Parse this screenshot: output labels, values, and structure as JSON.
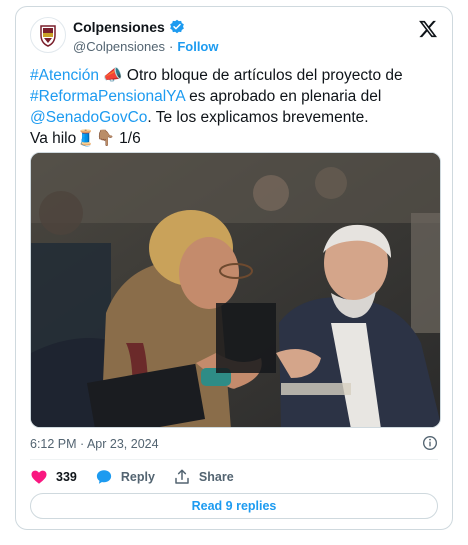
{
  "account": {
    "name": "Colpensiones",
    "handle": "@Colpensiones",
    "separator": "·",
    "follow_label": "Follow"
  },
  "tweet": {
    "line1_tag": "#Atención",
    "line1_emoji": "📣",
    "line1_rest": " Otro bloque de artículos del proyecto de",
    "line2_tag": "#ReformaPensionalYA",
    "line2_rest": " es aprobado en plenaria del",
    "line3_mention": "@SenadoGovCo",
    "line3_rest": ". Te los explicamos brevemente.",
    "line4_text": "Va hilo",
    "line4_emojis": "🧵👇🏽",
    "line4_count": " 1/6"
  },
  "meta": {
    "timestamp": "6:12 PM · Apr 23, 2024"
  },
  "actions": {
    "like_count": "339",
    "reply_label": "Reply",
    "share_label": "Share"
  },
  "read_replies_label": "Read 9 replies",
  "colors": {
    "accent": "#1d9bf0",
    "like": "#f91880",
    "text": "#0f1419",
    "muted": "#536471",
    "border": "#cfd9de"
  },
  "icons": [
    "colpensiones-logo-icon",
    "verified-badge-icon",
    "x-logo-icon",
    "info-icon",
    "heart-icon",
    "reply-bubble-icon",
    "share-icon"
  ]
}
